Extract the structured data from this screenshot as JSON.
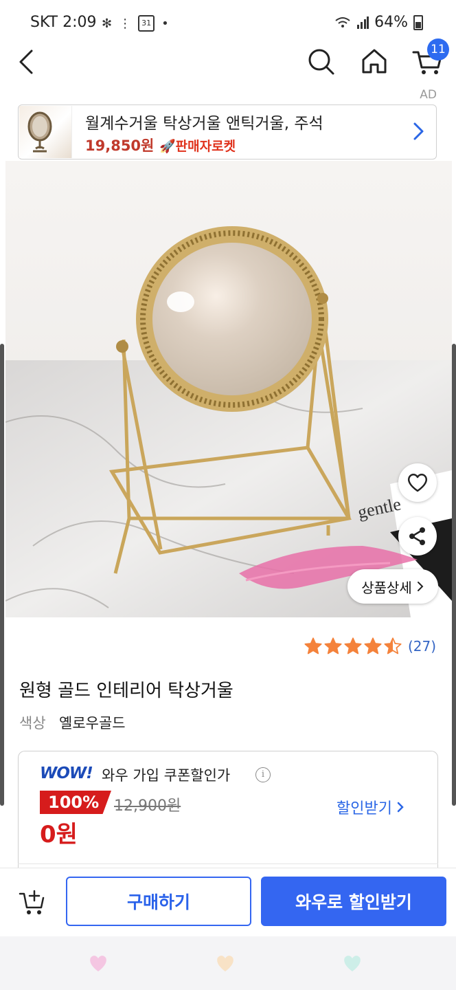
{
  "status_bar": {
    "time": "SKT 2:09",
    "calendar_day": "31",
    "battery": "64%"
  },
  "header": {
    "cart_count": "11"
  },
  "ad": {
    "label": "AD",
    "title": "월계수거울 탁상거울 앤틱거울, 주석",
    "price": "19,850원",
    "badge": "판매자로켓"
  },
  "product": {
    "detail_button": "상품상세",
    "rating": 4.5,
    "review_count": "(27)",
    "name": "원형 골드 인테리어 탁상거울",
    "color_label": "색상",
    "color_value": "옐로우골드"
  },
  "coupon": {
    "brand": "WOW!",
    "title": "와우 가입 쿠폰할인가",
    "info_icon": "i",
    "discount": "100%",
    "original_price": "12,900원",
    "final_price": "0원",
    "get_discount": "할인받기"
  },
  "bottom_bar": {
    "buy_label": "구매하기",
    "wow_buy_label": "와우로 할인받기"
  },
  "colors": {
    "accent_blue": "#3466f1",
    "sale_red": "#d61c1c",
    "star_orange": "#f4823b"
  }
}
